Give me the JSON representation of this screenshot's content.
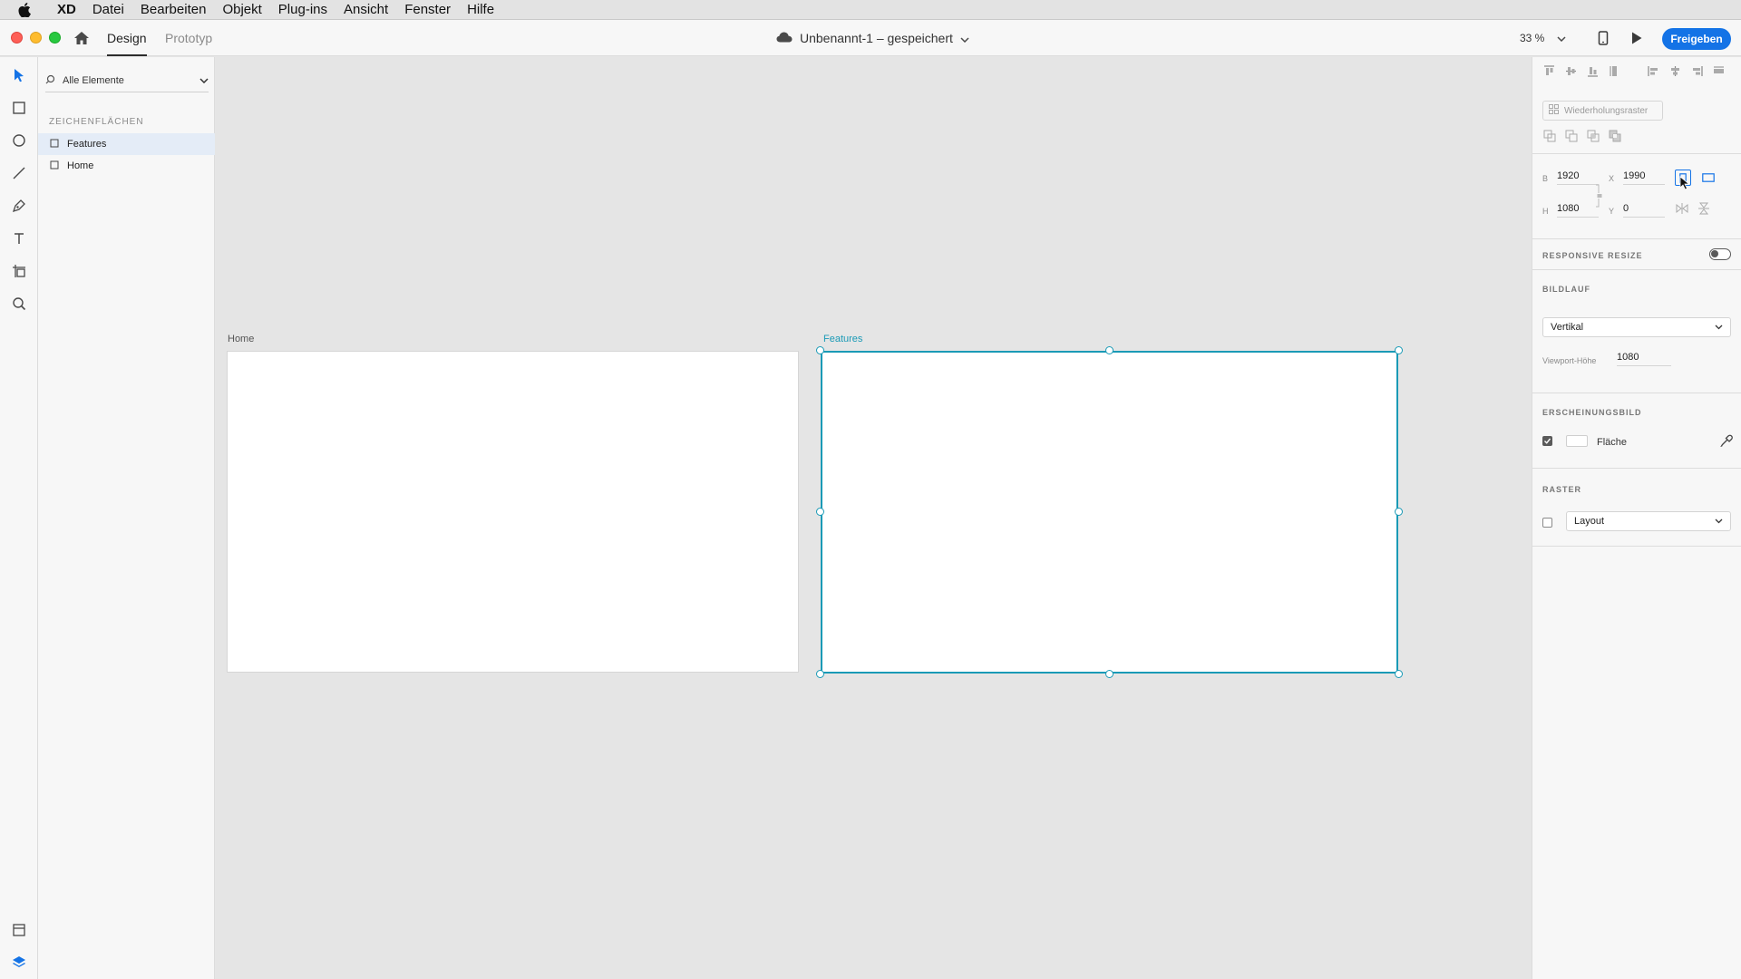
{
  "menubar": {
    "app": "XD",
    "items": [
      "Datei",
      "Bearbeiten",
      "Objekt",
      "Plug-ins",
      "Ansicht",
      "Fenster",
      "Hilfe"
    ]
  },
  "titlebar": {
    "tab_design": "Design",
    "tab_prototype": "Prototyp",
    "document_title": "Unbenannt-1 – gespeichert",
    "zoom": "33 %",
    "share_label": "Freigeben"
  },
  "layers": {
    "filter_label": "Alle Elemente",
    "section_title": "ZEICHENFLÄCHEN",
    "items": [
      {
        "label": "Features",
        "selected": true
      },
      {
        "label": "Home",
        "selected": false
      }
    ]
  },
  "canvas": {
    "artboards": [
      {
        "label": "Home",
        "selected": false
      },
      {
        "label": "Features",
        "selected": true
      }
    ]
  },
  "properties": {
    "repeat_grid_label": "Wiederholungsraster",
    "width_label": "B",
    "width_value": "1920",
    "x_label": "X",
    "x_value": "1990",
    "height_label": "H",
    "height_value": "1080",
    "y_label": "Y",
    "y_value": "0",
    "responsive_resize_label": "RESPONSIVE RESIZE",
    "responsive_resize_on": false,
    "scroll_label": "BILDLAUF",
    "scroll_value": "Vertikal",
    "viewport_height_label": "Viewport-Höhe",
    "viewport_height_value": "1080",
    "appearance_label": "ERSCHEINUNGSBILD",
    "fill_label": "Fläche",
    "fill_checked": true,
    "fill_color": "#ffffff",
    "grid_label": "RASTER",
    "grid_value": "Layout",
    "grid_checked": false
  },
  "colors": {
    "accent": "#1473e6",
    "selection": "#1a9ab6"
  }
}
